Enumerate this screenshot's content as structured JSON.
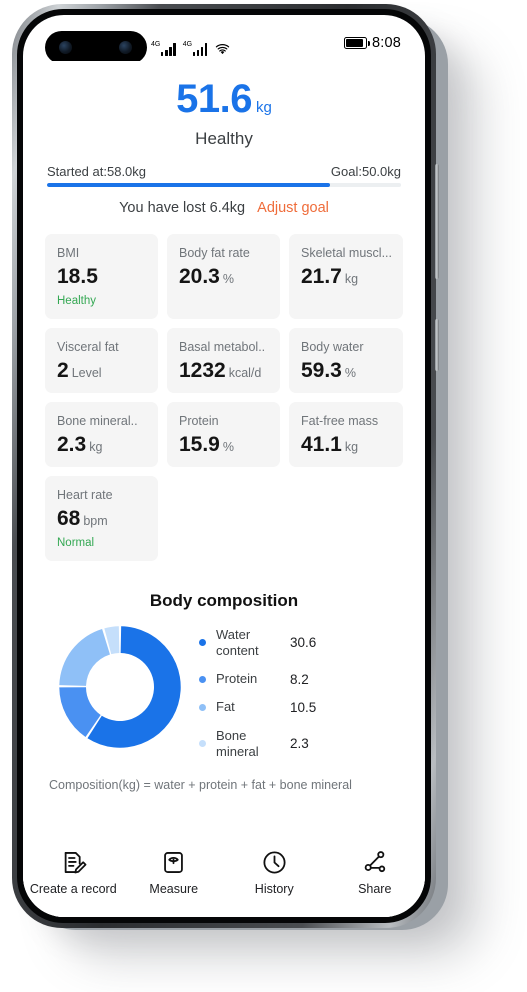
{
  "status_bar": {
    "network_label": "4G",
    "network_label_2": "4G",
    "time": "8:08",
    "icons": [
      "signal-icon",
      "signal-icon",
      "wifi-icon",
      "battery-icon"
    ]
  },
  "hero": {
    "weight_value": "51.6",
    "weight_unit": "kg",
    "status": "Healthy",
    "accent_color": "#1a73e8"
  },
  "progress": {
    "start_label": "Started at:58.0kg",
    "goal_label": "Goal:50.0kg",
    "fill_percent": 80,
    "note": "You have lost 6.4kg",
    "adjust_link": "Adjust goal",
    "link_color": "#ef6c3a",
    "fill_color": "#1a73e8"
  },
  "metrics": [
    {
      "label": "BMI",
      "value": "18.5",
      "unit": "",
      "note": "Healthy",
      "note_color": "#34a853"
    },
    {
      "label": "Body fat rate",
      "value": "20.3",
      "unit": "%",
      "note": "",
      "note_color": ""
    },
    {
      "label": "Skeletal muscl...",
      "value": "21.7",
      "unit": "kg",
      "note": "",
      "note_color": ""
    },
    {
      "label": "Visceral fat",
      "value": "2",
      "unit": "Level",
      "note": "",
      "note_color": ""
    },
    {
      "label": "Basal metabol..",
      "value": "1232",
      "unit": "kcal/d",
      "note": "",
      "note_color": ""
    },
    {
      "label": "Body water",
      "value": "59.3",
      "unit": "%",
      "note": "",
      "note_color": ""
    },
    {
      "label": "Bone mineral..",
      "value": "2.3",
      "unit": "kg",
      "note": "",
      "note_color": ""
    },
    {
      "label": "Protein",
      "value": "15.9",
      "unit": "%",
      "note": "",
      "note_color": ""
    },
    {
      "label": "Fat-free mass",
      "value": "41.1",
      "unit": "kg",
      "note": "",
      "note_color": ""
    },
    {
      "label": "Heart rate",
      "value": "68",
      "unit": "bpm",
      "note": "Normal",
      "note_color": "#34a853"
    }
  ],
  "composition": {
    "title": "Body composition",
    "footnote": "Composition(kg) = water + protein + fat + bone mineral"
  },
  "chart_data": {
    "type": "pie",
    "title": "Body composition",
    "categories": [
      "Water content",
      "Protein",
      "Fat",
      "Bone mineral"
    ],
    "values": [
      30.6,
      8.2,
      10.5,
      2.3
    ],
    "unit": "kg",
    "colors": [
      "#1a73e8",
      "#4a91f2",
      "#8fc0f7",
      "#c5dffb"
    ],
    "legend_position": "right",
    "donut": true,
    "inner_radius_ratio": 0.56,
    "start_angle_deg": 0,
    "direction": "clockwise",
    "total": 51.6,
    "xlabel": "",
    "ylabel": ""
  },
  "bottom_nav": [
    {
      "label": "Create a record",
      "icon": "create-record-icon"
    },
    {
      "label": "Measure",
      "icon": "scale-icon"
    },
    {
      "label": "History",
      "icon": "clock-icon"
    },
    {
      "label": "Share",
      "icon": "share-icon"
    }
  ]
}
